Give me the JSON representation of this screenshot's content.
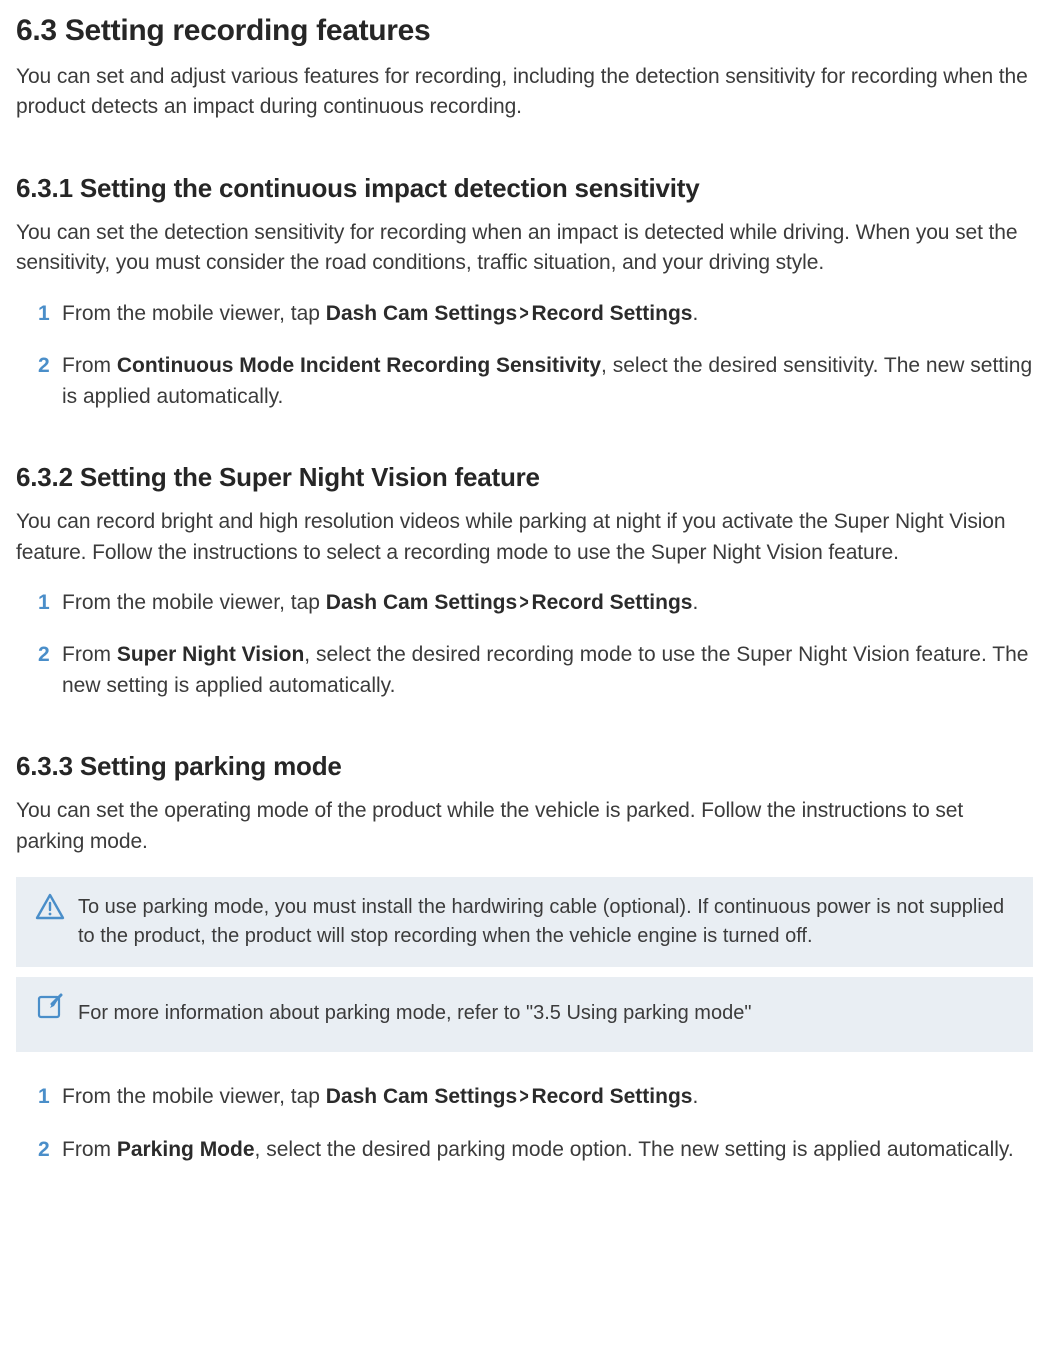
{
  "section": {
    "title": "6.3   Setting recording features",
    "intro": "You can set and adjust various features for recording, including the detection sensitivity for recording when the product detects an impact during continuous recording."
  },
  "sub1": {
    "title": "6.3.1   Setting the continuous impact detection sensitivity",
    "intro": "You can set the detection sensitivity for recording when an impact is detected while driving. When you set the sensitivity, you must consider the road conditions, traffic situation, and your driving style.",
    "step1_num": "1",
    "step1_pre": "From the mobile viewer, tap ",
    "step1_b1": "Dash Cam Settings",
    "step1_b2": "Record Settings",
    "step1_post": ".",
    "step2_num": "2",
    "step2_pre": "From ",
    "step2_b": "Continuous Mode Incident Recording Sensitivity",
    "step2_post": ", select the desired sensitivity. The new setting is applied automatically."
  },
  "sub2": {
    "title": "6.3.2   Setting the Super Night Vision feature",
    "intro": "You can record bright and high resolution videos while parking at night if you activate the Super Night Vision feature. Follow the instructions to select a recording mode to use the Super Night Vision feature.",
    "step1_num": "1",
    "step1_pre": "From the mobile viewer, tap ",
    "step1_b1": "Dash Cam Settings",
    "step1_b2": "Record Settings",
    "step1_post": ".",
    "step2_num": "2",
    "step2_pre": "From ",
    "step2_b": "Super Night Vision",
    "step2_post": ", select the desired recording mode to use the Super Night Vision feature. The new setting is applied automatically."
  },
  "sub3": {
    "title": "6.3.3   Setting parking mode",
    "intro": "You can set the operating mode of the product while the vehicle is parked. Follow the instructions to set parking mode.",
    "warn": "To use parking mode, you must install the hardwiring cable (optional). If continuous power is not supplied to the product, the product will stop recording when the vehicle engine is turned off.",
    "note": "For more information about parking mode, refer to \"3.5 Using parking mode\"",
    "step1_num": "1",
    "step1_pre": "From the mobile viewer, tap ",
    "step1_b1": "Dash Cam Settings",
    "step1_b2": "Record Settings",
    "step1_post": ".",
    "step2_num": "2",
    "step2_pre": "From ",
    "step2_b": "Parking Mode",
    "step2_post": ", select the desired parking mode option. The new setting is applied automatically."
  },
  "chevron": ">"
}
